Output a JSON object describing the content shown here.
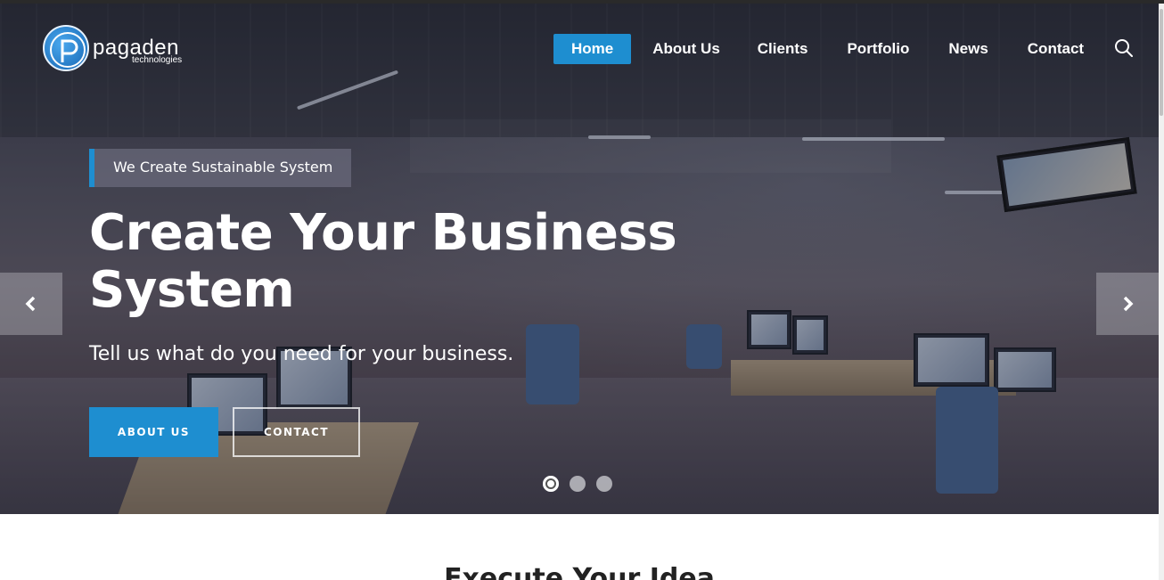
{
  "logo": {
    "name": "pagaden",
    "sub": "technologies"
  },
  "nav": {
    "items": [
      {
        "label": "Home",
        "active": true
      },
      {
        "label": "About Us"
      },
      {
        "label": "Clients"
      },
      {
        "label": "Portfolio"
      },
      {
        "label": "News"
      },
      {
        "label": "Contact"
      }
    ],
    "search_icon": "search-icon"
  },
  "hero": {
    "tagline": "We Create Sustainable System",
    "headline": "Create Your Business System",
    "subline": "Tell us what do you need for your business.",
    "primary_button": "ABOUT US",
    "secondary_button": "CONTACT",
    "slide_count": 3,
    "active_slide": 1
  },
  "section": {
    "title": "Execute Your Idea"
  },
  "colors": {
    "accent": "#1e8ed0"
  }
}
